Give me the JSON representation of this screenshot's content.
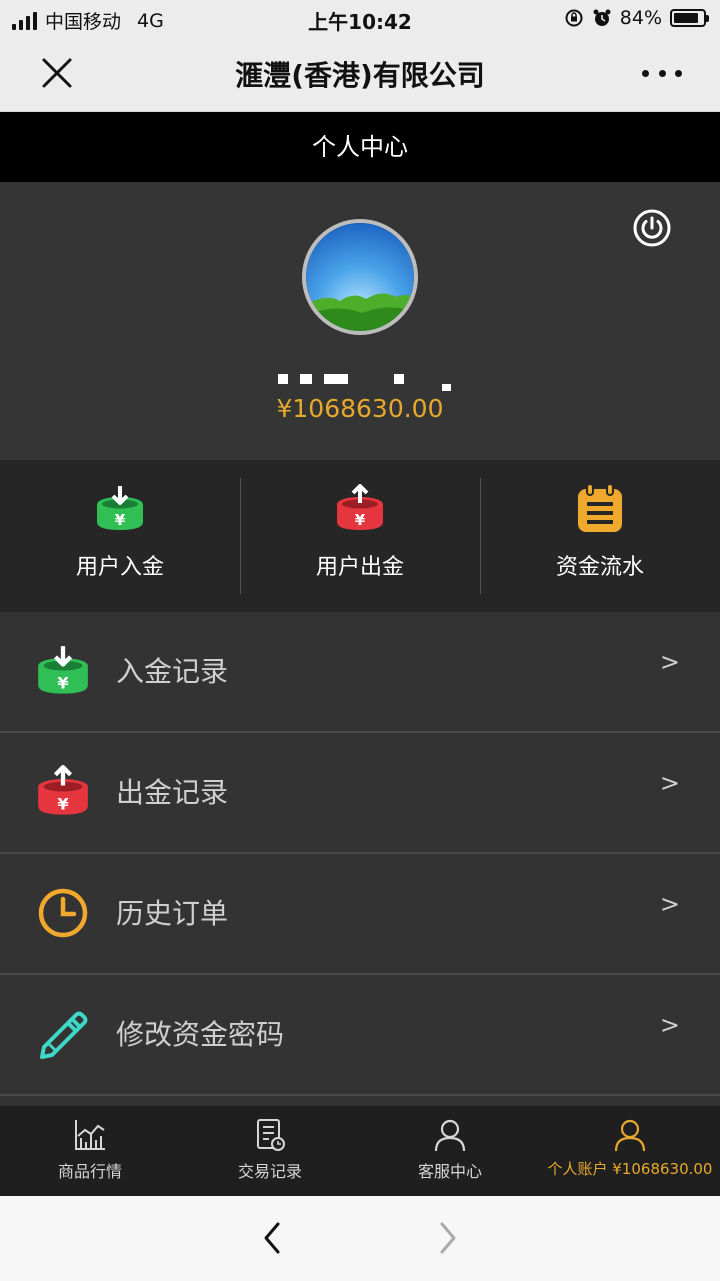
{
  "status_bar": {
    "carrier": "中国移动",
    "network": "4G",
    "time": "上午10:42",
    "battery_text": "84%",
    "battery_level": 0.84
  },
  "nav": {
    "title": "滙灃(香港)有限公司",
    "close_icon": "close-icon",
    "more_icon": "more-dots-icon"
  },
  "page": {
    "title": "个人中心"
  },
  "profile": {
    "balance": "¥1068630.00",
    "power_icon": "power-icon",
    "avatar_icon": "avatar-landscape"
  },
  "quick_actions": [
    {
      "label": "用户入金",
      "icon": "deposit-icon",
      "color": "#2fbf55"
    },
    {
      "label": "用户出金",
      "icon": "withdraw-icon",
      "color": "#e53640"
    },
    {
      "label": "资金流水",
      "icon": "clipboard-icon",
      "color": "#f0a92d"
    }
  ],
  "menu": [
    {
      "label": "入金记录",
      "icon": "deposit-icon",
      "chevron": ">"
    },
    {
      "label": "出金记录",
      "icon": "withdraw-icon",
      "chevron": ">"
    },
    {
      "label": "历史订单",
      "icon": "clock-icon",
      "chevron": ">"
    },
    {
      "label": "修改资金密码",
      "icon": "pencil-icon",
      "chevron": ">"
    }
  ],
  "tabs": [
    {
      "label": "商品行情",
      "icon": "chart-icon"
    },
    {
      "label": "交易记录",
      "icon": "record-icon"
    },
    {
      "label": "客服中心",
      "icon": "user-icon"
    },
    {
      "label": "个人账户 ¥1068630.00",
      "icon": "user-icon",
      "active": true
    }
  ],
  "colors": {
    "accent": "#e7a92d",
    "green": "#2fbf55",
    "red": "#e53640",
    "teal": "#3fd8c7"
  }
}
